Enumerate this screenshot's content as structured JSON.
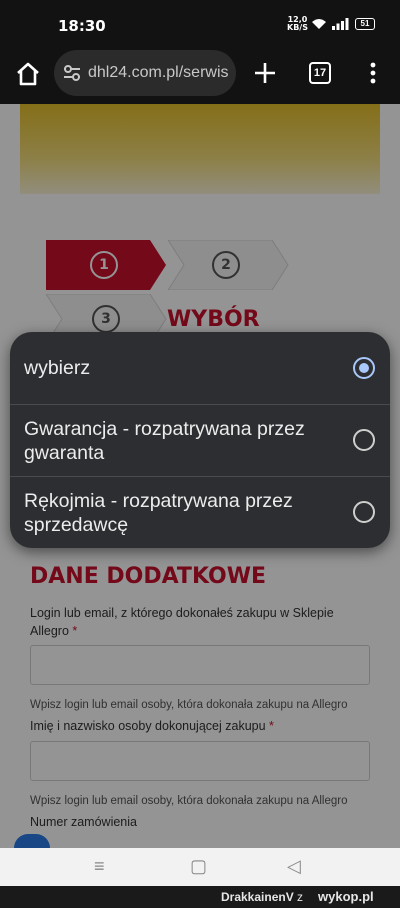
{
  "status": {
    "time": "18:30",
    "speed_value": "12,0",
    "speed_unit": "KB/S",
    "battery": "51"
  },
  "browser": {
    "url": "dhl24.com.pl/serwis",
    "tab_count": "17"
  },
  "steps": [
    {
      "num": "1",
      "active": true
    },
    {
      "num": "2",
      "active": false
    },
    {
      "num": "3",
      "active": false
    }
  ],
  "page": {
    "wybor_heading": "WYBÓR",
    "dane_heading": "DANE DODATKOWE",
    "field1_label": "Login lub email, z którego dokonałeś zakupu w Sklepie Allegro",
    "field1_hint": "Wpisz login lub email osoby, która dokonała zakupu na Allegro",
    "field2_label": "Imię i nazwisko osoby dokonującej zakupu",
    "field2_hint": "Wpisz login lub email osoby, która dokonała zakupu na Allegro",
    "field3_label": "Numer zamówienia",
    "required_mark": "*"
  },
  "dropdown": {
    "options": [
      {
        "label": "wybierz",
        "selected": true
      },
      {
        "label": "Gwarancja - rozpatrywana przez gwaranta",
        "selected": false
      },
      {
        "label": "Rękojmia - rozpatrywana przez sprzedawcę",
        "selected": false
      }
    ]
  },
  "navbar": {
    "menu_glyph": "≡",
    "home_glyph": "▢",
    "back_glyph": "◁"
  },
  "footer": {
    "user": "DrakkainenV",
    "z": "z",
    "site": "wykop.pl"
  },
  "colors": {
    "brand_red": "#c8102e",
    "brand_yellow": "#e4bf2b",
    "radio_selected": "#a8c7fa",
    "popup_bg": "#2d2e31"
  }
}
